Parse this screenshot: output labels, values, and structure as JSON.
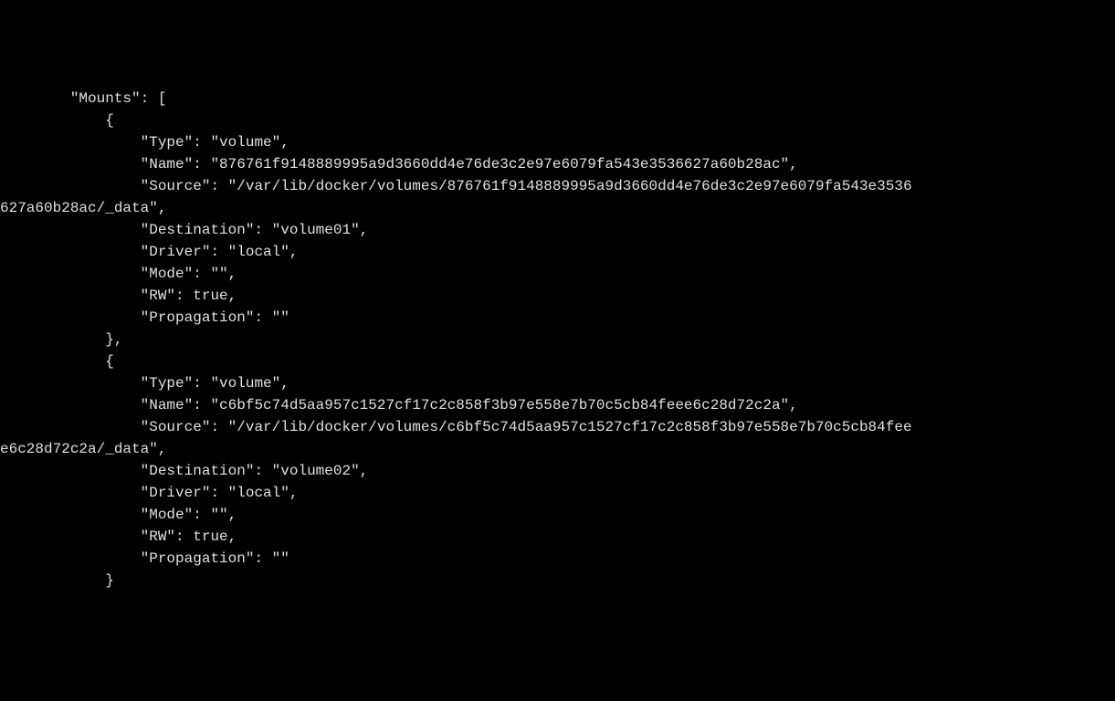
{
  "mounts_key": "\"Mounts\"",
  "mounts_open": ": [",
  "entries": [
    {
      "open": "{",
      "type_key": "\"Type\"",
      "type_val": "\"volume\"",
      "name_key": "\"Name\"",
      "name_val": "\"876761f9148889995a9d3660dd4e76de3c2e97e6079fa543e3536627a60b28ac\"",
      "source_key": "\"Source\"",
      "source_val_line1": "\"/var/lib/docker/volumes/876761f9148889995a9d3660dd4e76de3c2e97e6079fa543e3536",
      "source_val_line2": "627a60b28ac/_data\"",
      "dest_key": "\"Destination\"",
      "dest_val": "\"volume01\"",
      "driver_key": "\"Driver\"",
      "driver_val": "\"local\"",
      "mode_key": "\"Mode\"",
      "mode_val": "\"\"",
      "rw_key": "\"RW\"",
      "rw_val": "true",
      "prop_key": "\"Propagation\"",
      "prop_val": "\"\"",
      "close": "},"
    },
    {
      "open": "{",
      "type_key": "\"Type\"",
      "type_val": "\"volume\"",
      "name_key": "\"Name\"",
      "name_val": "\"c6bf5c74d5aa957c1527cf17c2c858f3b97e558e7b70c5cb84feee6c28d72c2a\"",
      "source_key": "\"Source\"",
      "source_val_line1": "\"/var/lib/docker/volumes/c6bf5c74d5aa957c1527cf17c2c858f3b97e558e7b70c5cb84fee",
      "source_val_line2": "e6c28d72c2a/_data\"",
      "dest_key": "\"Destination\"",
      "dest_val": "\"volume02\"",
      "driver_key": "\"Driver\"",
      "driver_val": "\"local\"",
      "mode_key": "\"Mode\"",
      "mode_val": "\"\"",
      "rw_key": "\"RW\"",
      "rw_val": "true",
      "prop_key": "\"Propagation\"",
      "prop_val": "\"\"",
      "close": "}"
    }
  ],
  "indent": {
    "l1": "        ",
    "l2": "            ",
    "l3": "                "
  },
  "colon": ": ",
  "comma": ","
}
